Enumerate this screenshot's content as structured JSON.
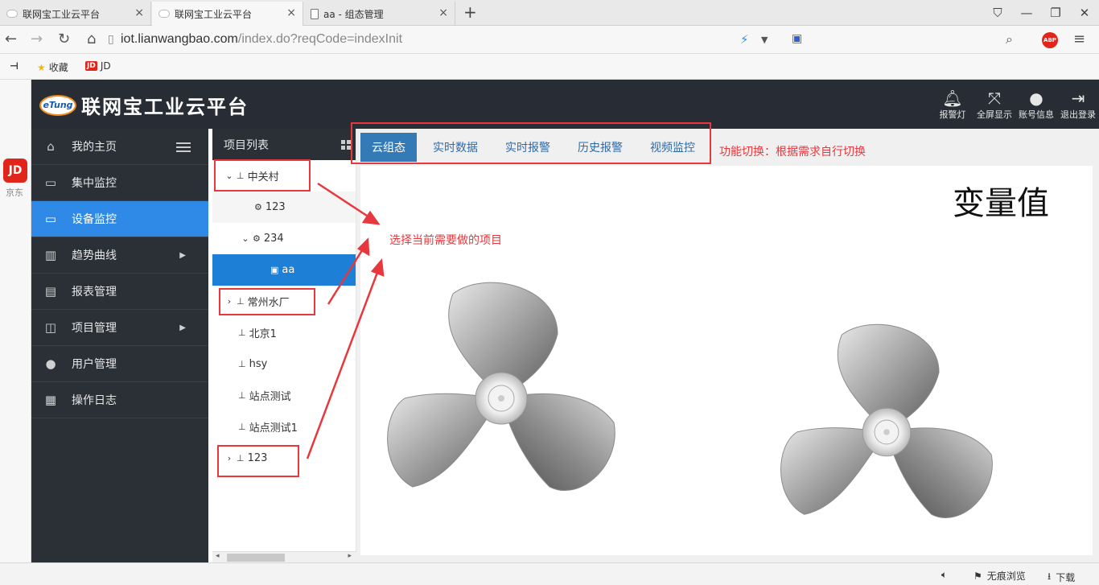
{
  "browser": {
    "tabs": [
      {
        "title": "联网宝工业云平台",
        "active": false
      },
      {
        "title": "联网宝工业云平台",
        "active": true
      },
      {
        "title": "aa - 组态管理",
        "active": false
      }
    ],
    "url_host": "iot.lianwangbao.com",
    "url_path": "/index.do?reqCode=indexInit",
    "bookmarks": {
      "favorites": "收藏",
      "jd": "JD"
    },
    "side_jd_label": "京东",
    "jd_badge": "JD",
    "abp": "ABP",
    "status": {
      "incognito": "无痕浏览",
      "download": "下载"
    }
  },
  "header": {
    "logo_text": "eTung",
    "title": "联网宝工业云平台",
    "actions": [
      {
        "label": "报警灯",
        "icon": "bell-icon"
      },
      {
        "label": "全屏显示",
        "icon": "fullscreen-icon"
      },
      {
        "label": "账号信息",
        "icon": "user-icon"
      },
      {
        "label": "退出登录",
        "icon": "logout-icon"
      }
    ]
  },
  "sidebar": {
    "items": [
      {
        "label": "我的主页",
        "icon": "home-icon"
      },
      {
        "label": "集中监控",
        "icon": "monitor-chart-icon"
      },
      {
        "label": "设备监控",
        "icon": "monitor-icon",
        "active": true
      },
      {
        "label": "趋势曲线",
        "icon": "bar-chart-icon",
        "caret": true
      },
      {
        "label": "报表管理",
        "icon": "document-icon"
      },
      {
        "label": "项目管理",
        "icon": "project-icon",
        "caret": true
      },
      {
        "label": "用户管理",
        "icon": "user-gear-icon"
      },
      {
        "label": "操作日志",
        "icon": "log-icon"
      }
    ]
  },
  "tree": {
    "header": "项目列表",
    "nodes": [
      {
        "label": "中关村",
        "toggle": "expanded",
        "icon": "sitemap-icon",
        "level": 0
      },
      {
        "label": "123",
        "icon": "gear-icon",
        "level": 1
      },
      {
        "label": "234",
        "toggle": "expanded",
        "icon": "gear-icon",
        "level": 1
      },
      {
        "label": "aa",
        "icon": "image-icon",
        "level": 2,
        "selected": true
      },
      {
        "label": "常州水厂",
        "toggle": "collapsed",
        "icon": "sitemap-icon",
        "level": 0
      },
      {
        "label": "北京1",
        "icon": "sitemap-icon",
        "level": 0
      },
      {
        "label": "hsy",
        "icon": "sitemap-icon",
        "level": 0
      },
      {
        "label": "站点测试",
        "icon": "sitemap-icon",
        "level": 0
      },
      {
        "label": "站点测试1",
        "icon": "sitemap-icon",
        "level": 0
      },
      {
        "label": "123",
        "toggle": "collapsed",
        "icon": "sitemap-icon",
        "level": 0
      }
    ]
  },
  "content": {
    "tabs": [
      "云组态",
      "实时数据",
      "实时报警",
      "历史报警",
      "视频监控"
    ],
    "active_tab": 0,
    "variable_label": "变量值"
  },
  "annotations": {
    "function_switch": "功能切换：根据需求自行切换",
    "select_project": "选择当前需要做的项目"
  },
  "colors": {
    "accent": "#2e8ae6",
    "sidebar": "#2b3037",
    "header": "#282d35",
    "annotation": "#e8383d",
    "tab_active": "#337ab7"
  }
}
